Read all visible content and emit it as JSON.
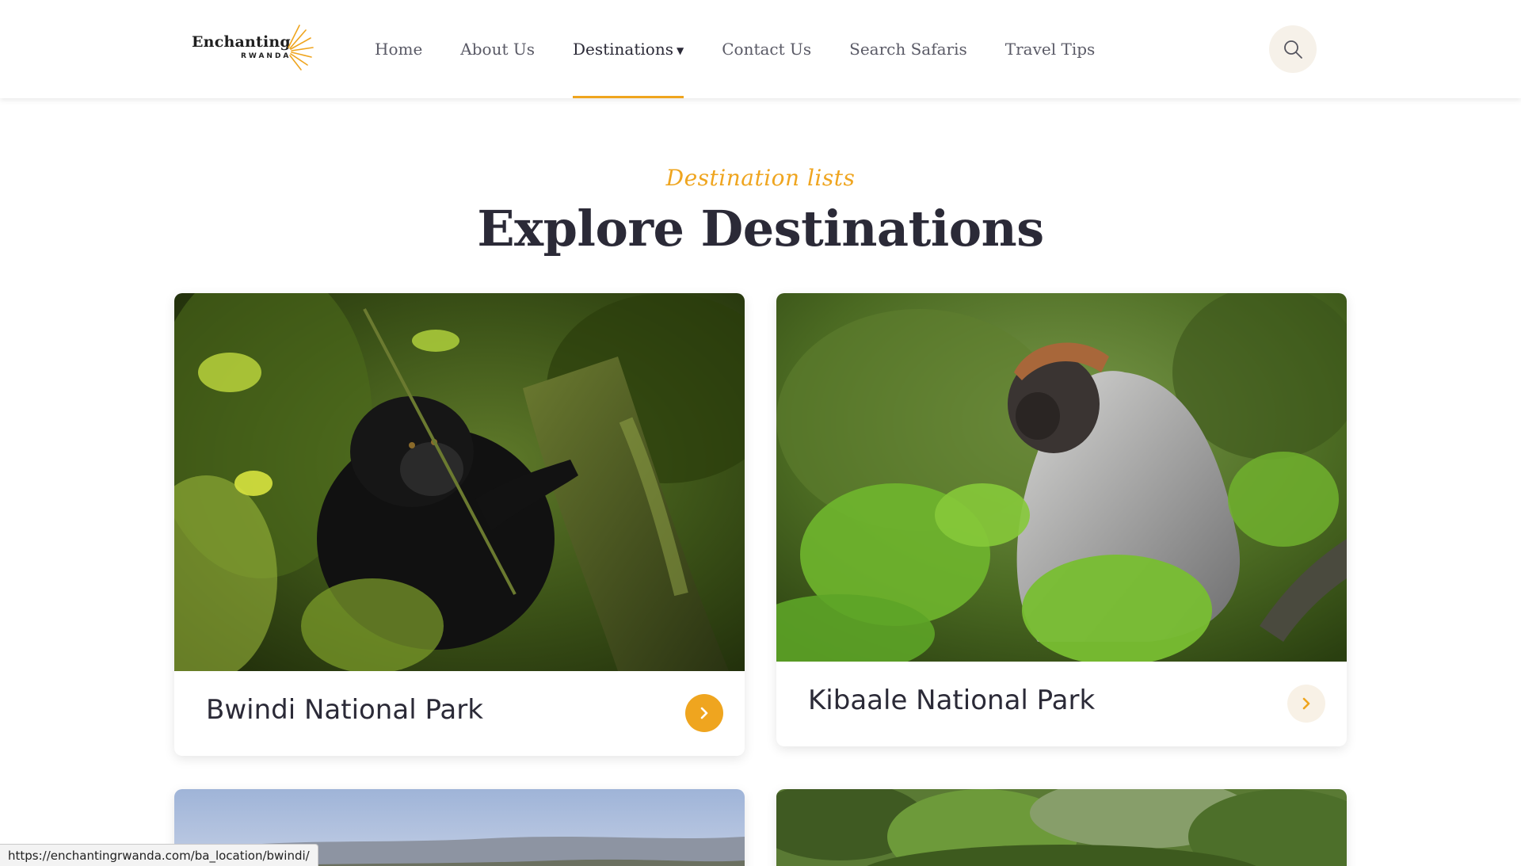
{
  "header": {
    "logo": {
      "main": "Enchanting",
      "sub": "RWANDA"
    },
    "nav": [
      {
        "label": "Home"
      },
      {
        "label": "About Us"
      },
      {
        "label": "Destinations",
        "active": true,
        "dropdown": true
      },
      {
        "label": "Contact Us"
      },
      {
        "label": "Search Safaris"
      },
      {
        "label": "Travel Tips"
      }
    ],
    "search_icon": "search-icon"
  },
  "section": {
    "subtitle": "Destination lists",
    "title": "Explore Destinations"
  },
  "cards": [
    {
      "name": "Bwindi National Park",
      "image": "gorilla-in-forest",
      "arrow": "chevron-right-icon",
      "hovered": true
    },
    {
      "name": "Kibaale National Park",
      "image": "monkey-in-foliage",
      "arrow": "chevron-right-icon",
      "hovered": false
    },
    {
      "name": "",
      "image": "savanna-landscape"
    },
    {
      "name": "",
      "image": "green-forest-landscape"
    }
  ],
  "status_bar": {
    "url": "https://enchantingrwanda.com/ba_location/bwindi/"
  },
  "colors": {
    "accent": "#efa51f",
    "text_dark": "#2b2a37",
    "nav_text": "#5a5a66",
    "soft_bg": "#f6f1e9"
  }
}
